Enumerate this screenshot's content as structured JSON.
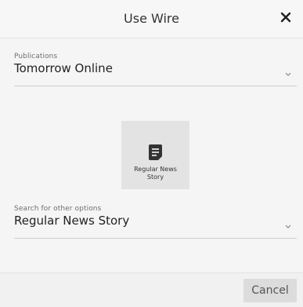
{
  "dialog": {
    "title": "Use Wire"
  },
  "publications": {
    "label": "Publications",
    "value": "Tomorrow Online"
  },
  "story_tile": {
    "label_line1": "Regular News",
    "label_line2": "Story"
  },
  "search_options": {
    "label": "Search for other options",
    "value": "Regular News Story"
  },
  "footer": {
    "cancel_label": "Cancel"
  }
}
